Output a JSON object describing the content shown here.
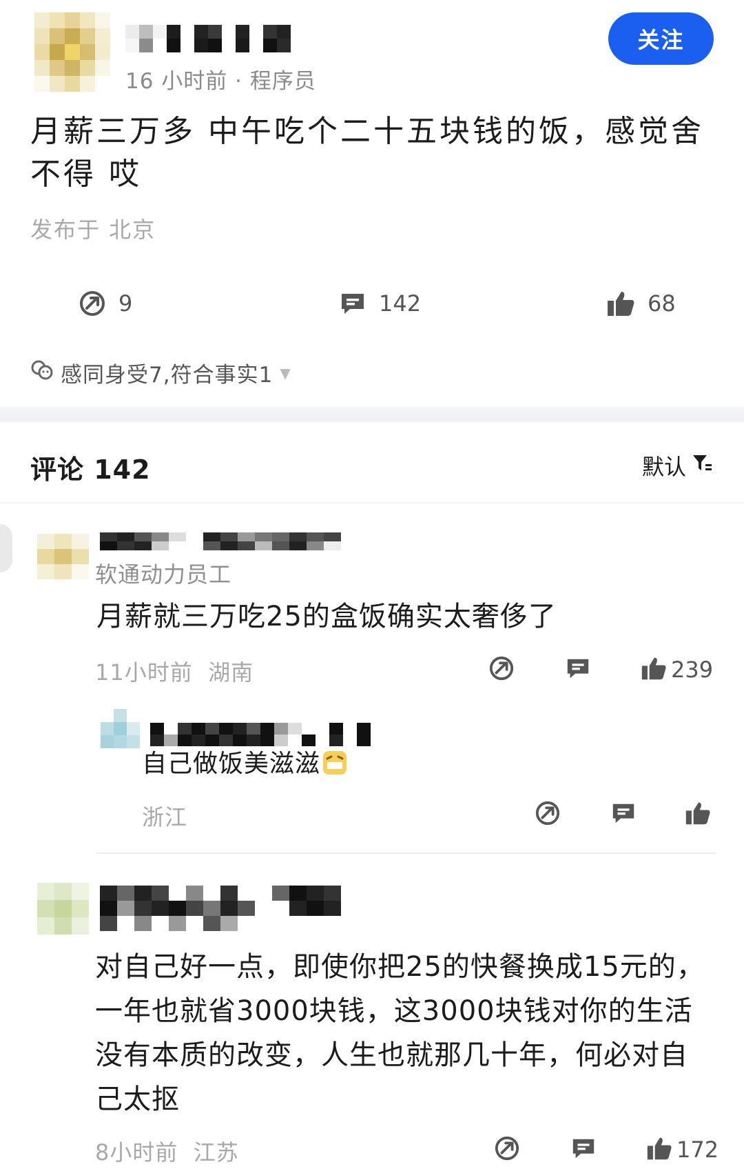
{
  "post": {
    "meta": "16 小时前 · 程序员",
    "follow_label": "关注",
    "text": "月薪三万多 中午吃个二十五块钱的饭，感觉舍不得 哎",
    "location": "发布于 北京",
    "actions": {
      "share_count": "9",
      "comment_count": "142",
      "like_count": "68"
    },
    "reactions": "感同身受7,符合事实1"
  },
  "comments_header": {
    "title": "评论 142",
    "sort_label": "默认"
  },
  "comments": [
    {
      "subtitle": "软通动力员工",
      "text": "月薪就三万吃25的盒饭确实太奢侈了",
      "meta": "11小时前  湖南",
      "like_count": "239",
      "reply": {
        "text": "自己做饭美滋滋",
        "meta": "浙江"
      }
    },
    {
      "text": "对自己好一点，即使你把25的快餐换成15元的，一年也就省3000块钱，这3000块钱对你的生活没有本质的改变，人生也就那几十年，何必对自己太抠",
      "meta": "8小时前  江苏",
      "like_count": "172"
    }
  ],
  "colors": {
    "accent": "#1b5ff0",
    "muted": "#a8a8a8",
    "text": "#1c1c1c"
  },
  "icons": [
    "share-icon",
    "comment-icon",
    "like-icon",
    "reaction-icon",
    "filter-icon",
    "grin-emoji-icon"
  ]
}
